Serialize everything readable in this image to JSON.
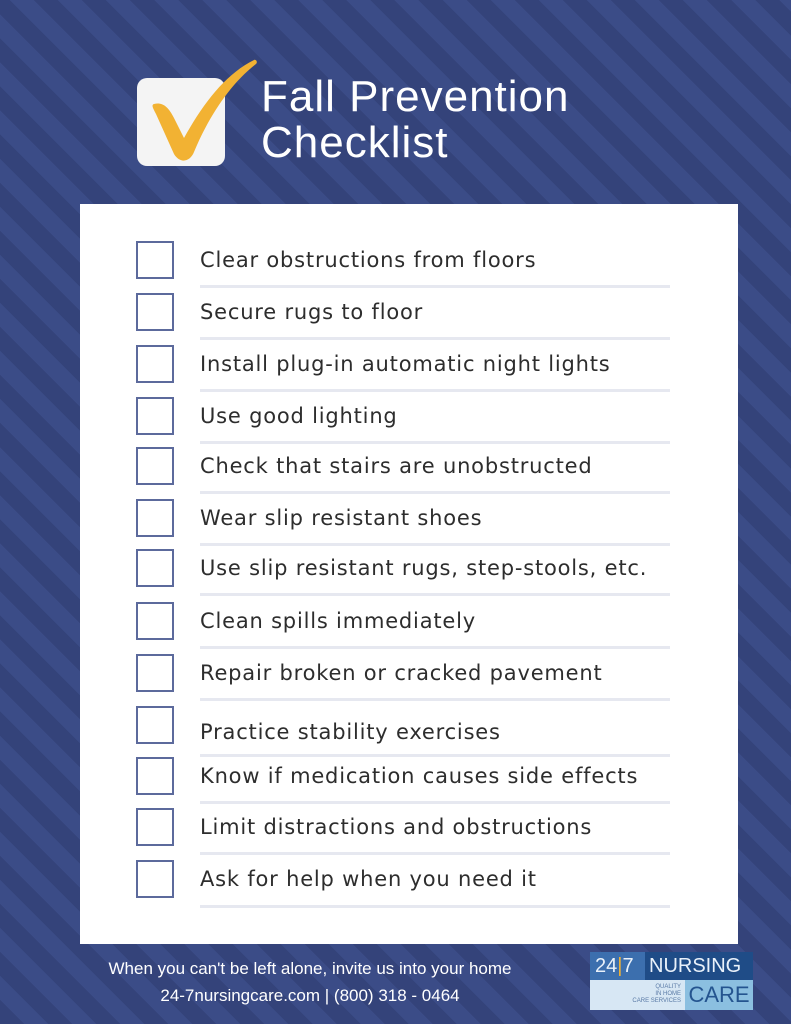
{
  "header": {
    "title_line1": "Fall Prevention",
    "title_line2": "Checklist",
    "icon": "checkmark-icon"
  },
  "colors": {
    "background": "#34437a",
    "stripe": "#3b4c87",
    "check": "#f2b233",
    "card": "#ffffff",
    "checkbox_border": "#5c6a9c",
    "rule": "#e6e8f0"
  },
  "checklist": {
    "items": [
      {
        "label": "Clear obstructions from floors",
        "checked": false
      },
      {
        "label": "Secure rugs to floor",
        "checked": false
      },
      {
        "label": "Install plug-in automatic night lights",
        "checked": false
      },
      {
        "label": "Use good lighting",
        "checked": false
      },
      {
        "label": "Check that stairs are unobstructed",
        "checked": false
      },
      {
        "label": "Wear slip resistant shoes",
        "checked": false
      },
      {
        "label": "Use slip resistant rugs, step-stools, etc.",
        "checked": false
      },
      {
        "label": "Clean spills immediately",
        "checked": false
      },
      {
        "label": "Repair broken or cracked pavement",
        "checked": false
      },
      {
        "label": "Practice stability exercises",
        "checked": false
      },
      {
        "label": "Know if medication causes side effects",
        "checked": false
      },
      {
        "label": "Limit distractions and obstructions",
        "checked": false
      },
      {
        "label": "Ask for help when you need it",
        "checked": false
      }
    ]
  },
  "footer": {
    "tagline": "When you can't be left alone, invite us into your home",
    "contact": "24-7nursingcare.com | (800) 318 - 0464"
  },
  "brand": {
    "num_a": "24",
    "num_sep": "|",
    "num_b": "7",
    "word1": "NURSING",
    "word2": "CARE",
    "sub1": "QUALITY",
    "sub2": "IN HOME",
    "sub3": "CARE SERVICES"
  }
}
